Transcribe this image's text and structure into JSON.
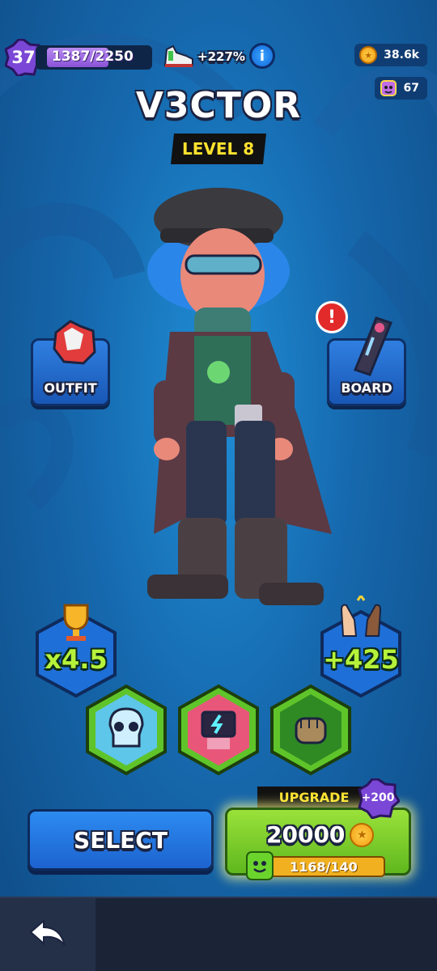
{
  "player": {
    "level": "37",
    "xp_text": "1387/2250",
    "xp_fraction": 0.616
  },
  "boost": {
    "text": "+227%",
    "icon": "sneaker-icon"
  },
  "currencies": {
    "coins": "38.6k",
    "gems": "67"
  },
  "character": {
    "name": "V3CTOR",
    "level_label": "LEVEL 8"
  },
  "side_buttons": {
    "outfit": "OUTFIT",
    "board": "BOARD",
    "board_alert": "!"
  },
  "stats": {
    "trophy_multiplier": "x4.5",
    "high_five": "+425"
  },
  "abilities": [
    "skull-ability-icon",
    "robot-ability-icon",
    "fist-ability-icon"
  ],
  "actions": {
    "select": "SELECT",
    "upgrade_label": "UPGRADE",
    "upgrade_cost": "20000",
    "upgrade_bonus": "+200",
    "cards_progress": "1168/140"
  },
  "colors": {
    "accent_green": "#6bd42c",
    "accent_yellow": "#ffe22e",
    "bg_blue": "#1668ad"
  }
}
